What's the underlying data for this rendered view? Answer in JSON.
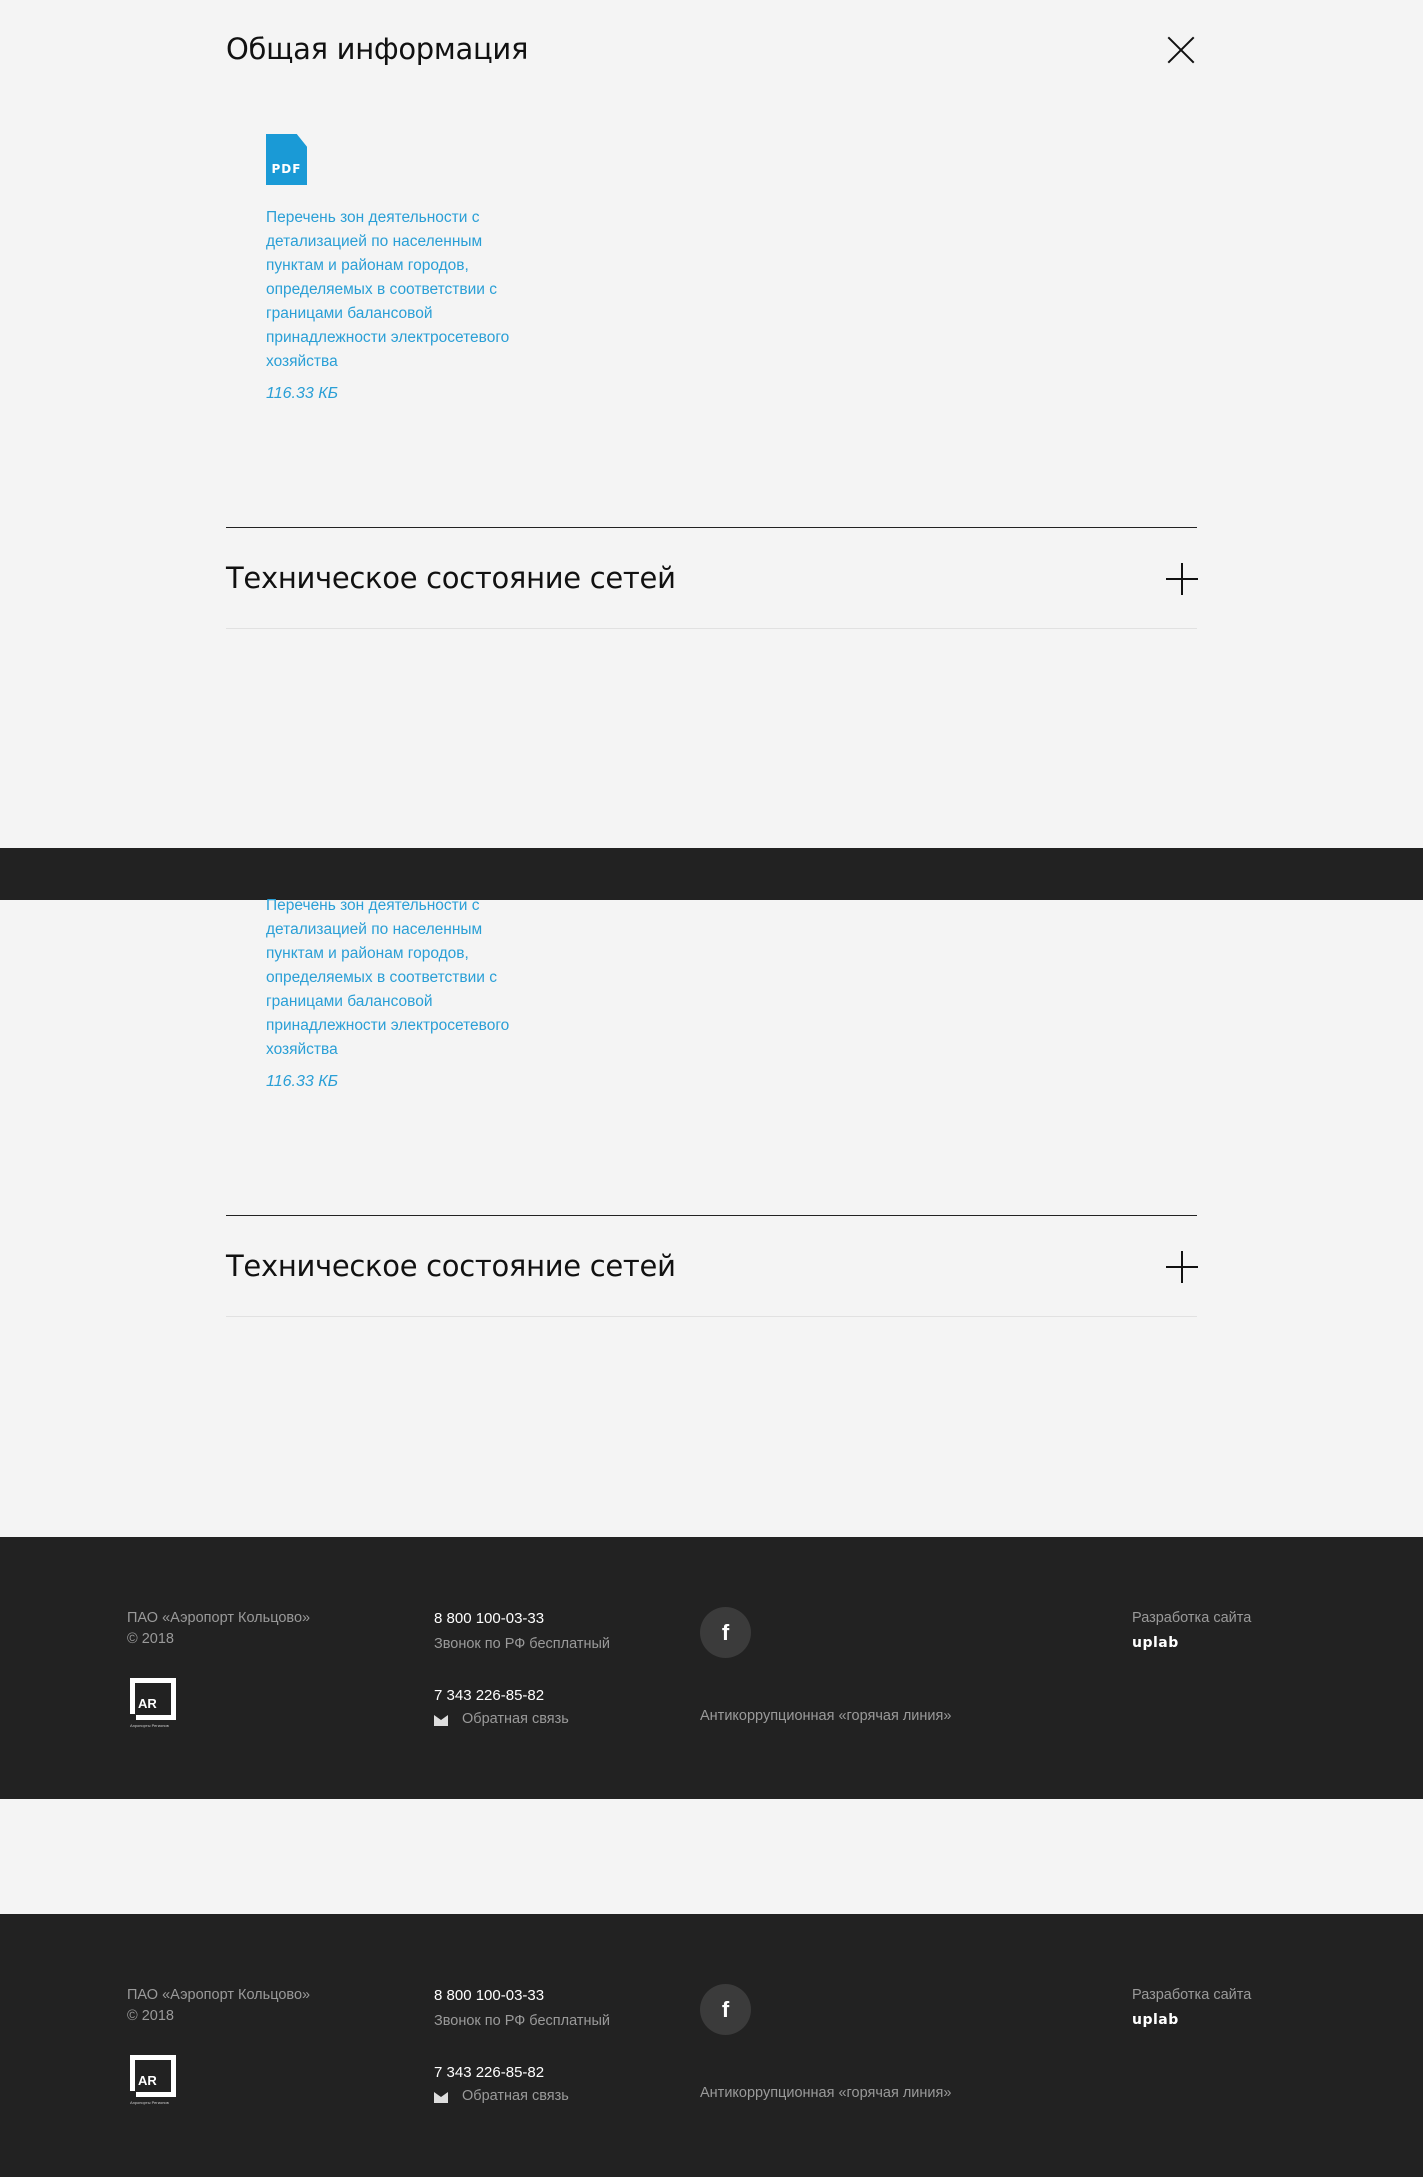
{
  "general": {
    "title": "Общая информация",
    "close_icon": "close-icon"
  },
  "document": {
    "icon_label": "PDF",
    "title": "Перечень зон деятельности с детализацией по населенным пунктам и районам городов, определяемых в соответствии с границами балансовой принадлежности электросетевого хозяйства",
    "size": "116.33 КБ"
  },
  "accordion": {
    "title": "Техническое состояние сетей",
    "expand_icon": "plus-icon"
  },
  "footer": {
    "company": "ПАО «Аэропорт Кольцово»",
    "copyright": "© 2018",
    "phone_free": "8 800 100-03-33",
    "phone_free_note": "Звонок по РФ бесплатный",
    "phone_local": "7 343 226-85-82",
    "feedback": "Обратная связь",
    "facebook_label": "f",
    "hotline": "Антикоррупционная «горячая линия»",
    "dev_label": "Разработка сайта",
    "dev_name": "uplab",
    "logo_text": "AR",
    "logo_caption": "Аэропорты Регионов"
  },
  "colors": {
    "accent": "#2a9fd6",
    "footer_bg": "#222222",
    "page_bg": "#f4f4f4"
  }
}
